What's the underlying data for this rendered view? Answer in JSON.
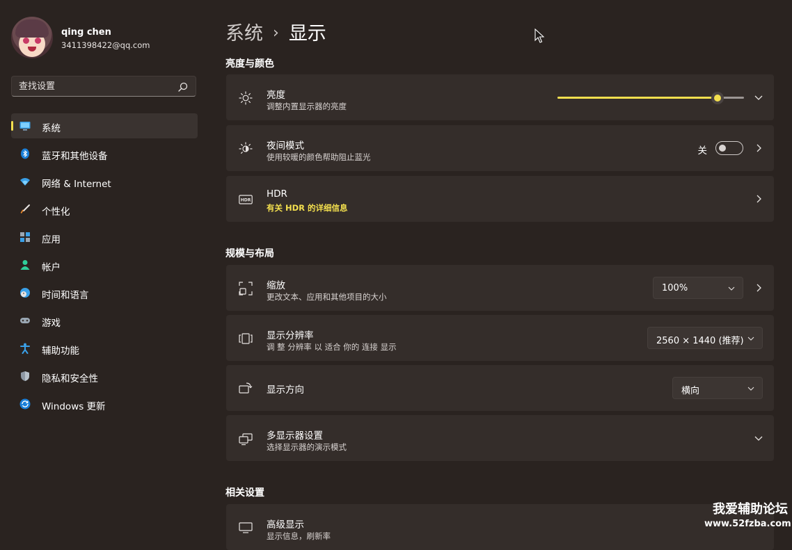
{
  "user": {
    "name": "qing chen",
    "email": "3411398422@qq.com"
  },
  "search": {
    "placeholder": "查找设置"
  },
  "nav": [
    {
      "label": "系统",
      "icon": "monitor-icon",
      "active": true
    },
    {
      "label": "蓝牙和其他设备",
      "icon": "bluetooth-icon"
    },
    {
      "label": "网络 & Internet",
      "icon": "wifi-icon"
    },
    {
      "label": "个性化",
      "icon": "brush-icon"
    },
    {
      "label": "应用",
      "icon": "apps-icon"
    },
    {
      "label": "帐户",
      "icon": "person-icon"
    },
    {
      "label": "时间和语言",
      "icon": "globe-clock-icon"
    },
    {
      "label": "游戏",
      "icon": "gamepad-icon"
    },
    {
      "label": "辅助功能",
      "icon": "accessibility-icon"
    },
    {
      "label": "隐私和安全性",
      "icon": "shield-icon"
    },
    {
      "label": "Windows 更新",
      "icon": "update-icon"
    }
  ],
  "breadcrumb": {
    "parent": "系统",
    "separator": "›",
    "current": "显示"
  },
  "sections": {
    "brightness_color": "亮度与颜色",
    "scale_layout": "规模与布局",
    "related": "相关设置"
  },
  "brightness": {
    "title": "亮度",
    "subtitle": "调整内置显示器的亮度",
    "value_fraction": 0.86
  },
  "night_light": {
    "title": "夜间模式",
    "subtitle": "使用较暖的颜色帮助阻止蓝光",
    "state_label": "关",
    "on": false
  },
  "hdr": {
    "title": "HDR",
    "link": "有关 HDR 的详细信息"
  },
  "scale": {
    "title": "缩放",
    "subtitle": "更改文本、应用和其他项目的大小",
    "value": "100%"
  },
  "resolution": {
    "title": "显示分辨率",
    "subtitle": "调 整 分辨率 以 适合 你的 连接 显示",
    "value": "2560 × 1440 (推荐)"
  },
  "orientation": {
    "title": "显示方向",
    "value": "横向"
  },
  "multi_display": {
    "title": "多显示器设置",
    "subtitle": "选择显示器的演示模式"
  },
  "advanced_display": {
    "title": "高级显示",
    "subtitle": "显示信息，刷新率"
  },
  "watermark": {
    "line1": "我爱辅助论坛",
    "line2": "www.52fzba.com"
  },
  "colors": {
    "accent": "#f3df4e",
    "background": "#2a2320",
    "card": "#342d2a"
  }
}
